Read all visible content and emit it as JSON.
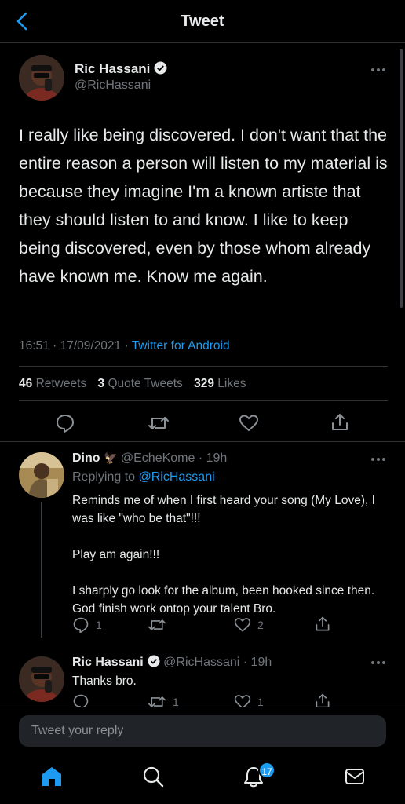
{
  "header": {
    "title": "Tweet"
  },
  "main_tweet": {
    "author_name": "Ric Hassani",
    "author_handle": "@RicHassani",
    "text": "I really like being discovered. I don't want that the entire reason a person will listen to my material is because they imagine I'm a known artiste that they should listen to and know. I like to keep being discovered, even by those whom already have known me. Know me again.",
    "time": "16:51",
    "date": "17/09/2021",
    "separator": "·",
    "source": "Twitter for Android",
    "retweets_count": "46",
    "retweets_label": "Retweets",
    "quotes_count": "3",
    "quotes_label": "Quote Tweets",
    "likes_count": "329",
    "likes_label": "Likes"
  },
  "replies": [
    {
      "name": "Dino",
      "emoji": "🦅",
      "handle": "@EcheKome",
      "time": "· 19h",
      "replying_prefix": "Replying to",
      "replying_to": "@RicHassani",
      "text": "Reminds me of when I first heard your song (My Love), I was like \"who be that\"!!!\n\nPlay am again!!!\n\nI sharply go look for the album, been hooked since then. God finish work ontop your talent Bro.",
      "reply_count": "1",
      "retweet_count": "",
      "like_count": "2"
    },
    {
      "name": "Ric Hassani",
      "handle": "@RicHassani",
      "time": "· 19h",
      "text": "Thanks bro.",
      "reply_count": "",
      "retweet_count": "1",
      "like_count": "1"
    }
  ],
  "composer": {
    "placeholder": "Tweet your reply"
  },
  "nav": {
    "items": [
      "home-icon",
      "search-icon",
      "notifications-icon",
      "messages-icon"
    ],
    "notifications_badge": "17"
  },
  "colors": {
    "accent": "#1d9bf0",
    "background": "#000000",
    "text": "#e7e9ea",
    "muted": "#71767b"
  }
}
